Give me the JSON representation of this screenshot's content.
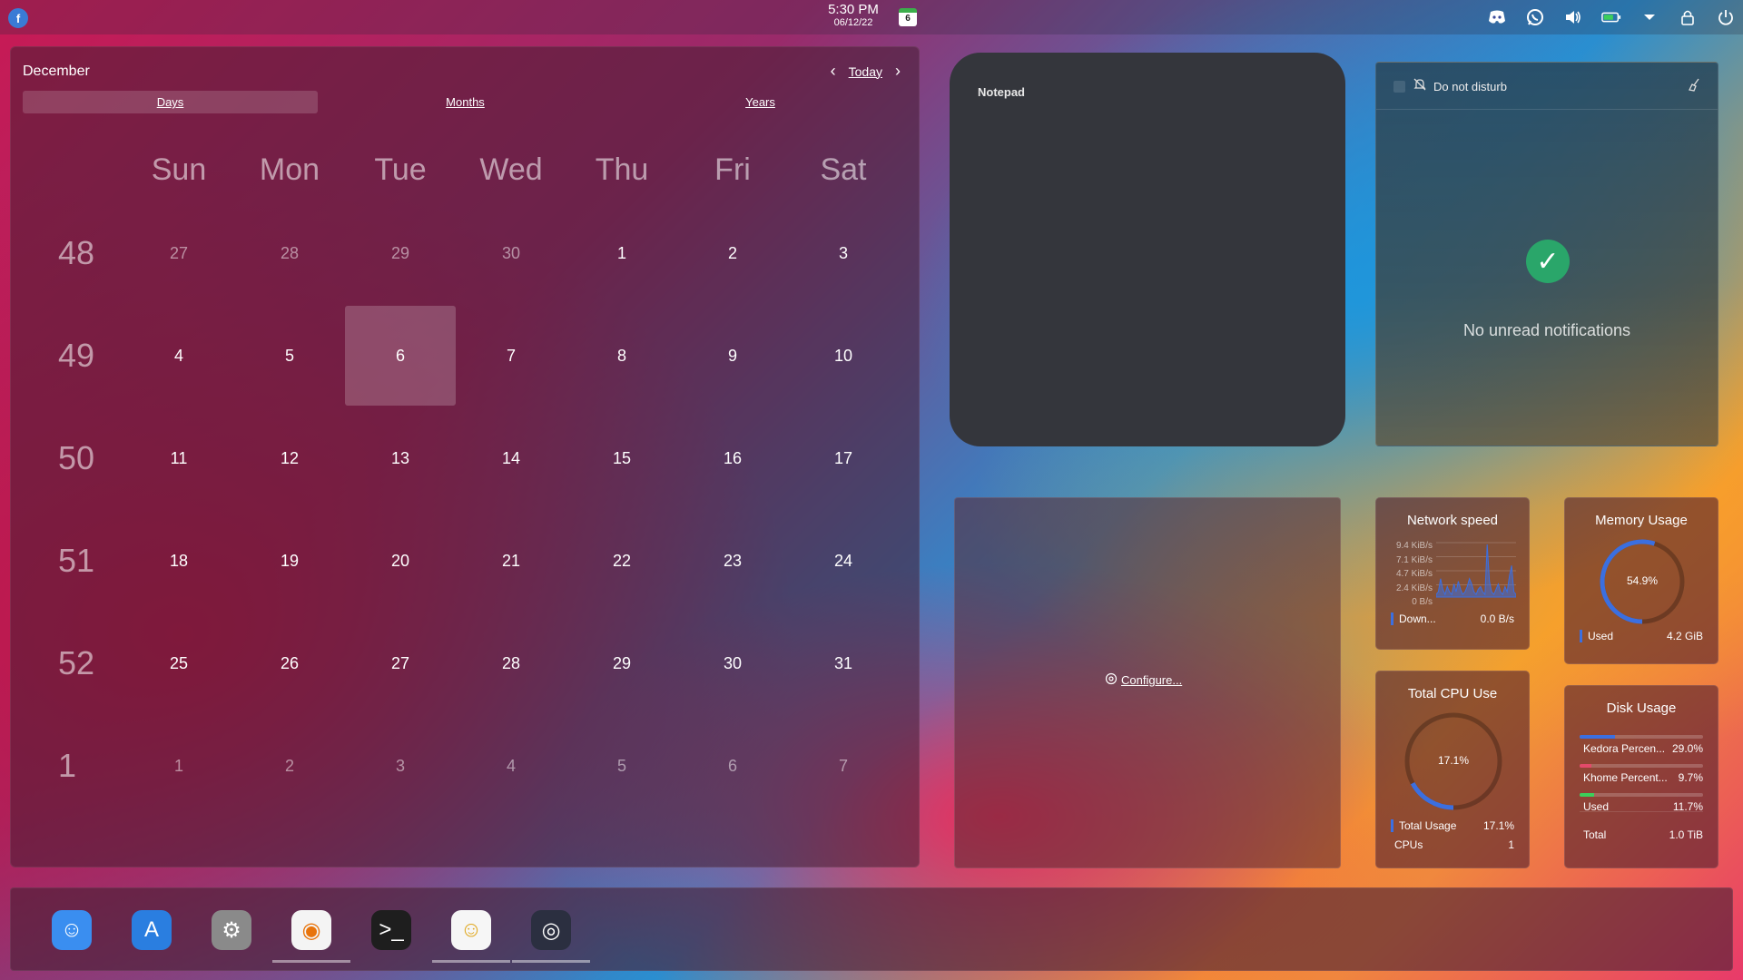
{
  "topbar": {
    "time": "5:30 PM",
    "date": "06/12/22",
    "calendar_icon_day": "6",
    "tray_icons": [
      "discord-icon",
      "whatsapp-icon",
      "volume-icon",
      "battery-icon",
      "expand-arrow-icon",
      "lock-icon",
      "power-icon"
    ]
  },
  "calendar": {
    "month": "December",
    "today_label": "Today",
    "tabs": [
      {
        "label": "Days",
        "active": true
      },
      {
        "label": "Months",
        "active": false
      },
      {
        "label": "Years",
        "active": false
      }
    ],
    "weekdays": [
      "Sun",
      "Mon",
      "Tue",
      "Wed",
      "Thu",
      "Fri",
      "Sat"
    ],
    "weeks": [
      {
        "num": "48",
        "days": [
          {
            "d": "27",
            "dim": true
          },
          {
            "d": "28",
            "dim": true
          },
          {
            "d": "29",
            "dim": true
          },
          {
            "d": "30",
            "dim": true
          },
          {
            "d": "1"
          },
          {
            "d": "2"
          },
          {
            "d": "3"
          }
        ]
      },
      {
        "num": "49",
        "days": [
          {
            "d": "4"
          },
          {
            "d": "5"
          },
          {
            "d": "6",
            "selected": true
          },
          {
            "d": "7"
          },
          {
            "d": "8"
          },
          {
            "d": "9"
          },
          {
            "d": "10"
          }
        ]
      },
      {
        "num": "50",
        "days": [
          {
            "d": "11"
          },
          {
            "d": "12"
          },
          {
            "d": "13"
          },
          {
            "d": "14"
          },
          {
            "d": "15"
          },
          {
            "d": "16"
          },
          {
            "d": "17"
          }
        ]
      },
      {
        "num": "51",
        "days": [
          {
            "d": "18"
          },
          {
            "d": "19"
          },
          {
            "d": "20"
          },
          {
            "d": "21"
          },
          {
            "d": "22"
          },
          {
            "d": "23"
          },
          {
            "d": "24"
          }
        ]
      },
      {
        "num": "52",
        "days": [
          {
            "d": "25"
          },
          {
            "d": "26"
          },
          {
            "d": "27"
          },
          {
            "d": "28"
          },
          {
            "d": "29"
          },
          {
            "d": "30"
          },
          {
            "d": "31"
          }
        ]
      },
      {
        "num": "1",
        "days": [
          {
            "d": "1",
            "dim": true
          },
          {
            "d": "2",
            "dim": true
          },
          {
            "d": "3",
            "dim": true
          },
          {
            "d": "4",
            "dim": true
          },
          {
            "d": "5",
            "dim": true
          },
          {
            "d": "6",
            "dim": true
          },
          {
            "d": "7",
            "dim": true
          }
        ]
      }
    ]
  },
  "notepad": {
    "title": "Notepad"
  },
  "notifications": {
    "dnd_label": "Do not disturb",
    "empty_text": "No unread notifications"
  },
  "configure": {
    "label": "Configure..."
  },
  "network": {
    "title": "Network speed",
    "axis": [
      "9.4 KiB/s",
      "7.1 KiB/s",
      "4.7 KiB/s",
      "2.4 KiB/s",
      "0 B/s"
    ],
    "legend_label": "Down...",
    "legend_value": "0.0 B/s",
    "spikes": [
      0.05,
      0.1,
      0.35,
      0.15,
      0.05,
      0.2,
      0.1,
      0.05,
      0.25,
      0.1,
      0.3,
      0.15,
      0.05,
      0.1,
      0.2,
      0.35,
      0.25,
      0.1,
      0.05,
      0.15,
      0.2,
      0.1,
      0.05,
      1.0,
      0.3,
      0.1,
      0.05,
      0.15,
      0.25,
      0.1,
      0.05,
      0.2,
      0.1,
      0.4,
      0.6,
      0.1,
      0.05
    ],
    "accent": "#3b6fe0"
  },
  "memory": {
    "title": "Memory Usage",
    "percent_label": "54.9%",
    "fraction": 0.549,
    "legend_label": "Used",
    "legend_value": "4.2 GiB",
    "accent": "#3b6fe0"
  },
  "cpu": {
    "title": "Total CPU Use",
    "percent_label": "17.1%",
    "fraction": 0.171,
    "legend_label": "Total Usage",
    "legend_value": "17.1%",
    "cpus_label": "CPUs",
    "cpus_value": "1",
    "accent": "#3b6fe0"
  },
  "disk": {
    "title": "Disk Usage",
    "rows": [
      {
        "label": "Kedora Percen...",
        "value": "29.0%",
        "fraction": 0.29,
        "color": "#3b6fe0"
      },
      {
        "label": "Khome Percent...",
        "value": "9.7%",
        "fraction": 0.097,
        "color": "#e24a6a"
      },
      {
        "label": "Used",
        "value": "11.7%",
        "fraction": 0.117,
        "color": "#3ccf5a"
      }
    ],
    "total_label": "Total",
    "total_value": "1.0 TiB"
  },
  "dock": {
    "items": [
      {
        "name": "finder",
        "running": false,
        "glyph": "☺",
        "bg": "#3a8ef0"
      },
      {
        "name": "app-store",
        "running": false,
        "glyph": "A",
        "bg": "#2a7ee0"
      },
      {
        "name": "system-settings",
        "running": false,
        "glyph": "⚙",
        "bg": "#8a8a8a"
      },
      {
        "name": "firefox",
        "running": true,
        "glyph": "◉",
        "bg": "#f4f4f4"
      },
      {
        "name": "terminal",
        "running": false,
        "glyph": ">_",
        "bg": "#1e1e1e"
      },
      {
        "name": "emoji-app",
        "running": true,
        "glyph": "☺",
        "bg": "#f6f6f6"
      },
      {
        "name": "screenshot-tool",
        "running": true,
        "glyph": "◎",
        "bg": "#2b2f40"
      }
    ]
  }
}
